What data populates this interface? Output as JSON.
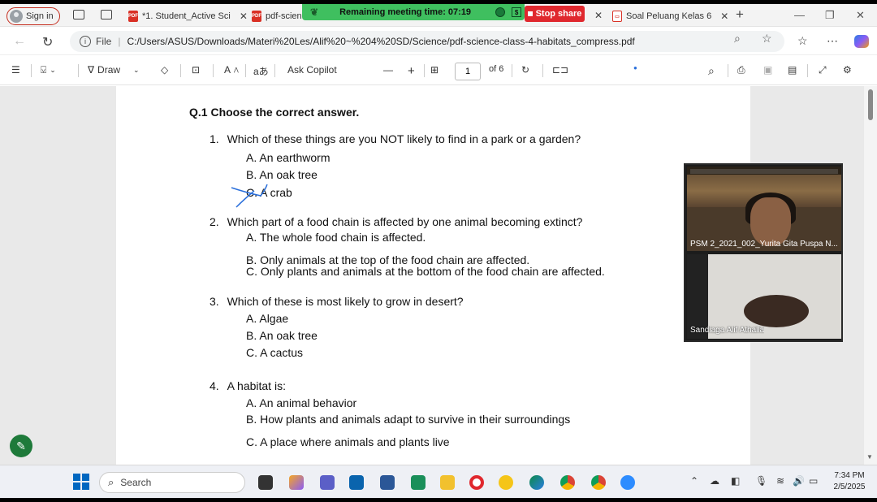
{
  "browser": {
    "signin_label": "Sign in",
    "tabs": [
      {
        "label": "*1. Student_Active Sci",
        "active": false
      },
      {
        "label": "pdf-scien",
        "active": true
      },
      {
        "label": "Soal Peluang Kelas 6",
        "active": false
      }
    ],
    "new_tab": "+",
    "address": {
      "file_label": "File",
      "url": "C:/Users/ASUS/Downloads/Materi%20Les/Alif%20~%204%20SD/Science/pdf-science-class-4-habitats_compress.pdf"
    }
  },
  "meeting": {
    "remaining_label": "Remaining meeting time: 07:19",
    "dollar_icon": "$",
    "stop_share_label": "Stop share"
  },
  "pdf_toolbar": {
    "draw_label": "Draw",
    "ask_copilot_label": "Ask Copilot",
    "current_page": "1",
    "page_total": "of 6"
  },
  "document": {
    "section_title": "Q.1 Choose the correct answer.",
    "questions": [
      {
        "number": "1.",
        "text": "Which of these things are you NOT likely to find in a park or a garden?",
        "options": [
          {
            "letter": "A.",
            "text": "An earthworm"
          },
          {
            "letter": "B.",
            "text": "An oak tree"
          },
          {
            "letter": "C.",
            "text": "A crab"
          }
        ]
      },
      {
        "number": "2.",
        "text": "Which part of a food chain is affected by one animal becoming extinct?",
        "options": [
          {
            "letter": "A.",
            "text": "The whole food chain is affected."
          },
          {
            "letter": "B.",
            "text": "Only animals at the top of the food chain are affected."
          },
          {
            "letter": "C.",
            "text": "Only plants and animals at the bottom of the food chain are affected."
          }
        ]
      },
      {
        "number": "3.",
        "text": "Which of these is most likely to grow in desert?",
        "options": [
          {
            "letter": "A.",
            "text": "Algae"
          },
          {
            "letter": "B.",
            "text": "An oak tree"
          },
          {
            "letter": "C.",
            "text": "A cactus"
          }
        ]
      },
      {
        "number": "4.",
        "text": "A habitat is:",
        "options": [
          {
            "letter": "A.",
            "text": "An animal behavior"
          },
          {
            "letter": "B.",
            "text": "How plants and animals adapt to survive in their surroundings"
          },
          {
            "letter": "C.",
            "text": "A place where animals and plants live"
          }
        ]
      }
    ]
  },
  "video_panel": {
    "participants": [
      {
        "name": "PSM 2_2021_002_Yurita Gita Puspa N..."
      },
      {
        "name": "Sandiaga Alif Athalla"
      }
    ]
  },
  "taskbar": {
    "search_placeholder": "Search",
    "time": "7:34 PM",
    "date": "2/5/2025"
  },
  "colors": {
    "meeting_green": "#3fbf5f",
    "stop_share_red": "#e0282e",
    "annotation_blue": "#2a6fdb"
  }
}
